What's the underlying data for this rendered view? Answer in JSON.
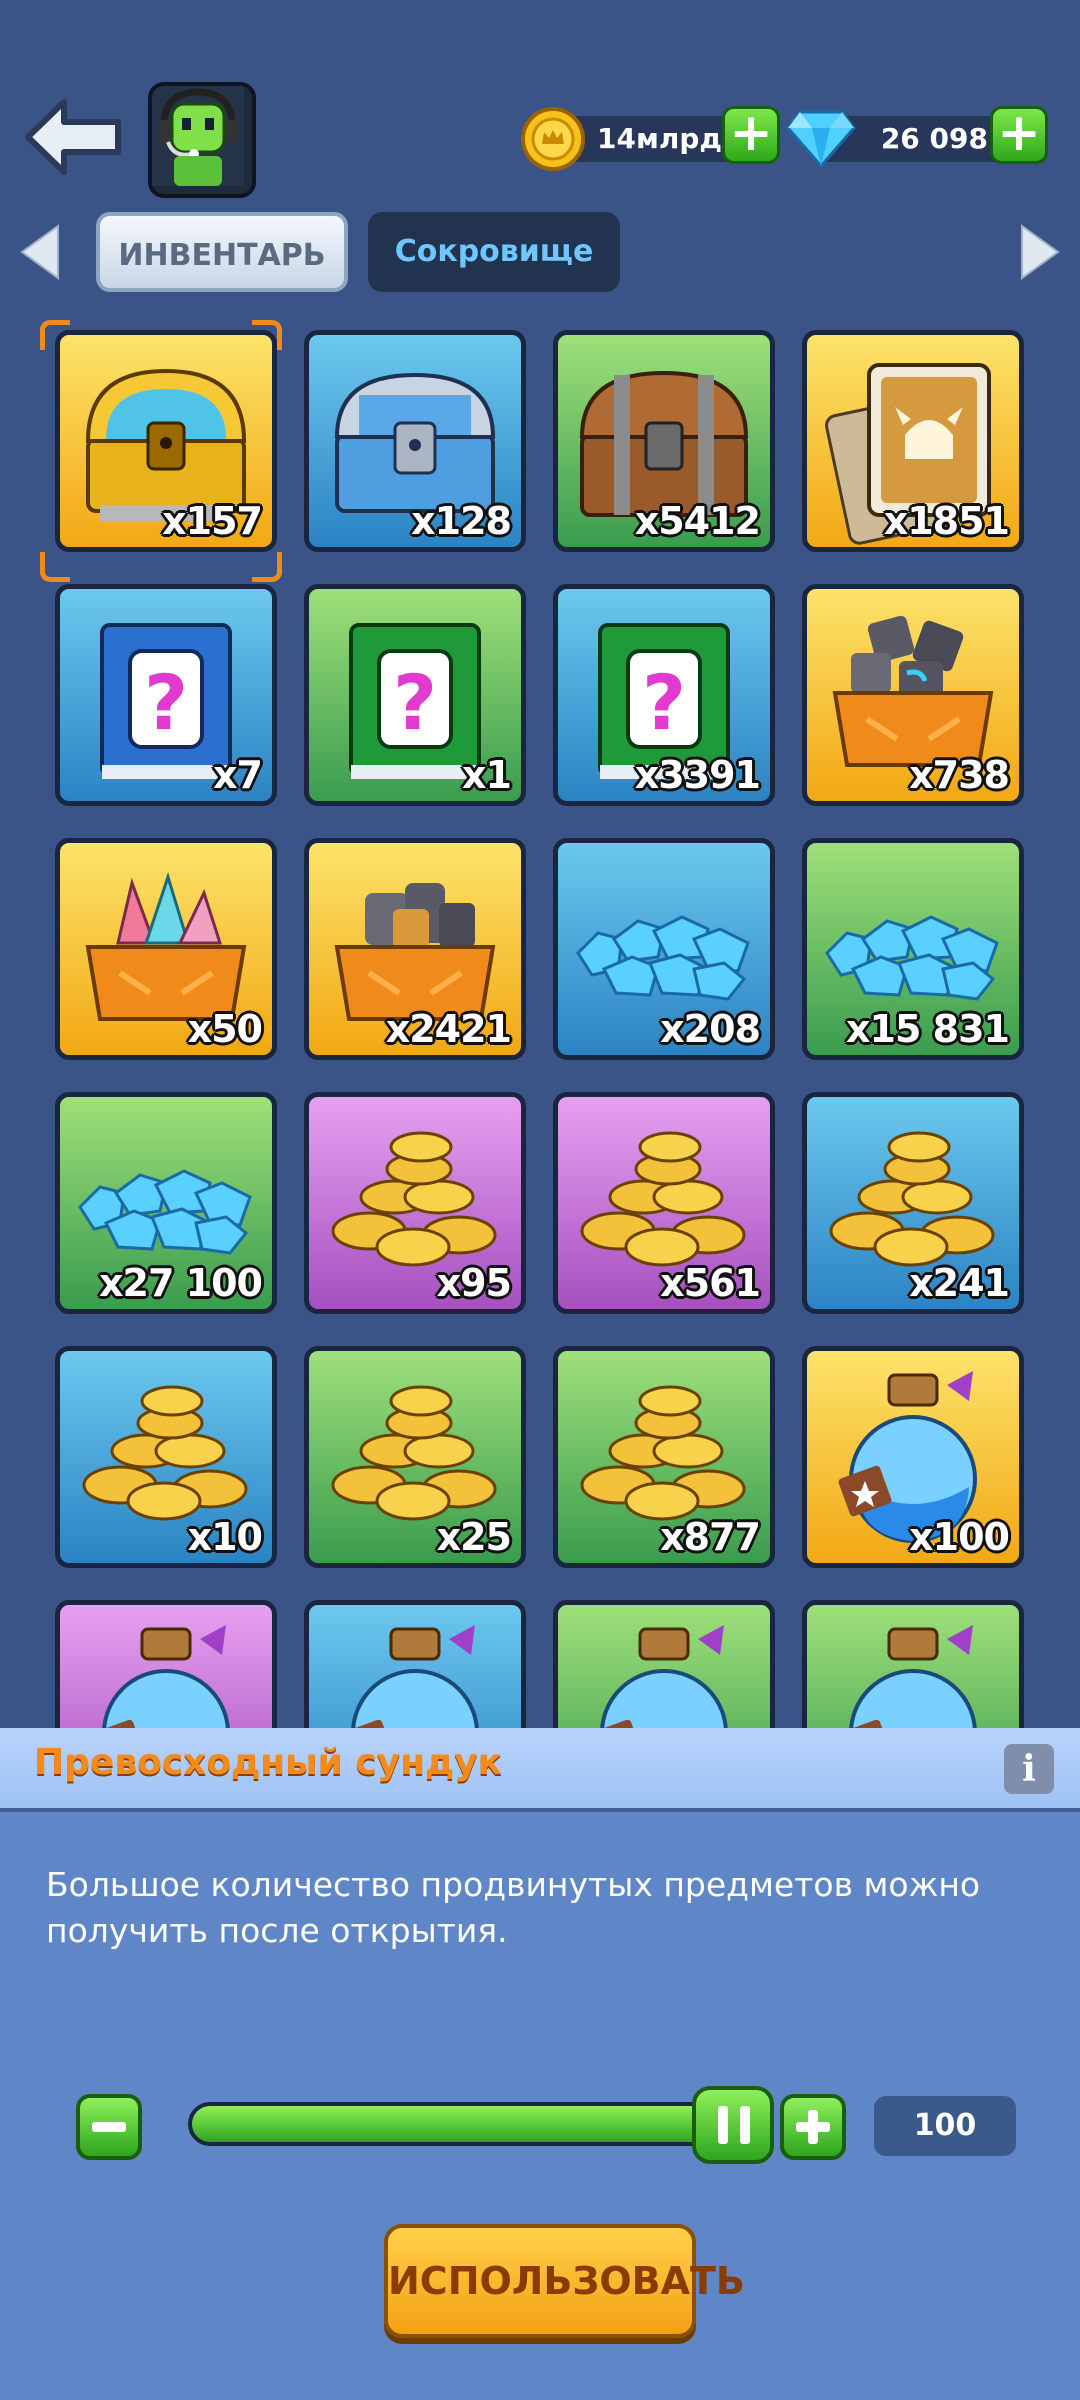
{
  "colors": {
    "background": "#3b5488",
    "accent_green": "#2ea51e",
    "title_orange": "#f48a1a"
  },
  "header": {
    "back_icon": "back-arrow-icon",
    "coins": {
      "icon": "coin-icon",
      "value": "14млрд"
    },
    "gems": {
      "icon": "gem-icon",
      "value": "26 098"
    }
  },
  "tabs": [
    {
      "label": "ИНВЕНТАРЬ",
      "active": false
    },
    {
      "label": "Сокровище",
      "active": true
    }
  ],
  "items": [
    {
      "icon": "gold-chest-icon",
      "frame": "gold",
      "count": "x157"
    },
    {
      "icon": "silver-chest-icon",
      "frame": "blue",
      "count": "x128"
    },
    {
      "icon": "wooden-chest-icon",
      "frame": "green",
      "count": "x5412"
    },
    {
      "icon": "hero-cards-icon",
      "frame": "gold",
      "count": "x1851"
    },
    {
      "icon": "mystery-book-blue-icon",
      "frame": "blue",
      "count": "x7"
    },
    {
      "icon": "mystery-book-green-icon",
      "frame": "green",
      "count": "x1"
    },
    {
      "icon": "mystery-book-green-icon",
      "frame": "blue",
      "count": "x3391"
    },
    {
      "icon": "rune-stones-crate-icon",
      "frame": "gold",
      "count": "x738"
    },
    {
      "icon": "crystal-crate-icon",
      "frame": "gold",
      "count": "x50"
    },
    {
      "icon": "ore-crate-icon",
      "frame": "gold",
      "count": "x2421"
    },
    {
      "icon": "diamond-pile-icon",
      "frame": "blue",
      "count": "x208"
    },
    {
      "icon": "diamond-pile-icon",
      "frame": "green",
      "count": "x15 831"
    },
    {
      "icon": "diamond-pile-icon",
      "frame": "green",
      "count": "x27 100"
    },
    {
      "icon": "coin-pile-icon",
      "frame": "purple",
      "count": "x95"
    },
    {
      "icon": "coin-pile-icon",
      "frame": "purple",
      "count": "x561"
    },
    {
      "icon": "coin-pile-icon",
      "frame": "blue",
      "count": "x241"
    },
    {
      "icon": "coin-pile-icon",
      "frame": "blue",
      "count": "x10"
    },
    {
      "icon": "coin-pile-icon",
      "frame": "green",
      "count": "x25"
    },
    {
      "icon": "coin-pile-icon",
      "frame": "green",
      "count": "x877"
    },
    {
      "icon": "potion-flask-icon",
      "frame": "gold",
      "count": "x100"
    },
    {
      "icon": "potion-flask-icon",
      "frame": "purple",
      "count": ""
    },
    {
      "icon": "potion-flask-icon",
      "frame": "blue",
      "count": ""
    },
    {
      "icon": "potion-flask-icon",
      "frame": "green",
      "count": ""
    },
    {
      "icon": "potion-flask-icon",
      "frame": "green",
      "count": ""
    }
  ],
  "detail": {
    "title": "Превосходный сундук",
    "info_label": "i",
    "description": "Большое количество продвинутых предметов можно получить после открытия.",
    "quantity": "100",
    "slider_fraction": 1.0,
    "use_label": "ИСПОЛЬЗОВАТЬ"
  }
}
